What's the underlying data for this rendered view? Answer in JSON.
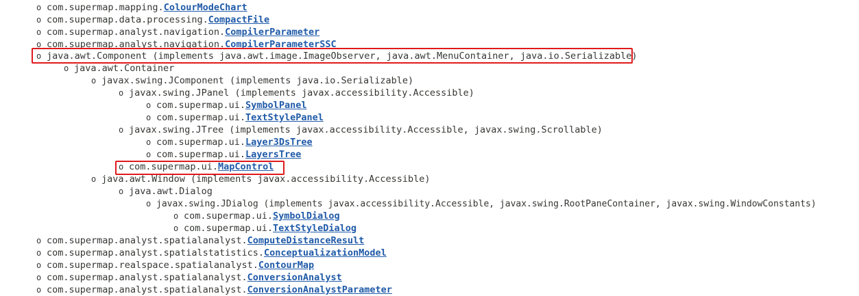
{
  "rows": [
    {
      "bullet": "o",
      "pkg": "com.supermap.mapping.",
      "cls": "ColourModeChart",
      "impl": ""
    },
    {
      "bullet": "o",
      "pkg": "com.supermap.data.processing.",
      "cls": "CompactFile",
      "impl": ""
    },
    {
      "bullet": "o",
      "pkg": "com.supermap.analyst.navigation.",
      "cls": "CompilerParameter",
      "impl": ""
    },
    {
      "bullet": "o",
      "pkg": "com.supermap.analyst.navigation.",
      "cls": "CompilerParameterSSC",
      "impl": ""
    },
    {
      "bullet": "o",
      "pkg": "java.awt.Component",
      "cls": "",
      "impl": " (implements java.awt.image.ImageObserver, java.awt.MenuContainer, java.io.Serializable)"
    },
    {
      "bullet": "o",
      "pkg": "java.awt.Container",
      "cls": "",
      "impl": ""
    },
    {
      "bullet": "o",
      "pkg": "javax.swing.JComponent",
      "cls": "",
      "impl": " (implements java.io.Serializable)"
    },
    {
      "bullet": "o",
      "pkg": "javax.swing.JPanel",
      "cls": "",
      "impl": " (implements javax.accessibility.Accessible)"
    },
    {
      "bullet": "o",
      "pkg": "com.supermap.ui.",
      "cls": "SymbolPanel",
      "impl": ""
    },
    {
      "bullet": "o",
      "pkg": "com.supermap.ui.",
      "cls": "TextStylePanel",
      "impl": ""
    },
    {
      "bullet": "o",
      "pkg": "javax.swing.JTree",
      "cls": "",
      "impl": " (implements javax.accessibility.Accessible, javax.swing.Scrollable)"
    },
    {
      "bullet": "o",
      "pkg": "com.supermap.ui.",
      "cls": "Layer3DsTree",
      "impl": ""
    },
    {
      "bullet": "o",
      "pkg": "com.supermap.ui.",
      "cls": "LayersTree",
      "impl": ""
    },
    {
      "bullet": "o",
      "pkg": "com.supermap.ui.",
      "cls": "MapControl",
      "impl": ""
    },
    {
      "bullet": "o",
      "pkg": "java.awt.Window",
      "cls": "",
      "impl": " (implements javax.accessibility.Accessible)"
    },
    {
      "bullet": "o",
      "pkg": "java.awt.Dialog",
      "cls": "",
      "impl": ""
    },
    {
      "bullet": "o",
      "pkg": "javax.swing.JDialog",
      "cls": "",
      "impl": " (implements javax.accessibility.Accessible, javax.swing.RootPaneContainer, javax.swing.WindowConstants)"
    },
    {
      "bullet": "o",
      "pkg": "com.supermap.ui.",
      "cls": "SymbolDialog",
      "impl": ""
    },
    {
      "bullet": "o",
      "pkg": "com.supermap.ui.",
      "cls": "TextStyleDialog",
      "impl": ""
    },
    {
      "bullet": "o",
      "pkg": "com.supermap.analyst.spatialanalyst.",
      "cls": "ComputeDistanceResult",
      "impl": ""
    },
    {
      "bullet": "o",
      "pkg": "com.supermap.analyst.spatialstatistics.",
      "cls": "ConceptualizationModel",
      "impl": ""
    },
    {
      "bullet": "o",
      "pkg": "com.supermap.realspace.spatialanalyst.",
      "cls": "ContourMap",
      "impl": ""
    },
    {
      "bullet": "o",
      "pkg": "com.supermap.analyst.spatialanalyst.",
      "cls": "ConversionAnalyst",
      "impl": ""
    },
    {
      "bullet": "o",
      "pkg": "com.supermap.analyst.spatialanalyst.",
      "cls": "ConversionAnalystParameter",
      "impl": ""
    }
  ],
  "highlight_color": "#e0191c",
  "link_color": "#1f5aa8"
}
